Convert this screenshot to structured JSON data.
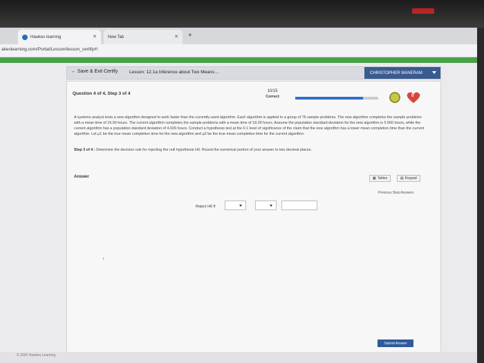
{
  "browser": {
    "tabs": [
      {
        "label": "Hawkes learning",
        "active": true
      },
      {
        "label": "New Tab",
        "active": false
      }
    ],
    "url": "akeslearning.com/Portal/Lesson/lesson_certify#!"
  },
  "nav": {
    "back_label": "Save & Exit Certify",
    "lesson_title": "Lesson: 12.1a Inference about Two Means:...",
    "user_name": "CHRISTOPHER MANERAM"
  },
  "question": {
    "header": "Question 4 of 4, Step 3 of 4",
    "score_value": "10/15",
    "score_status": "Correct",
    "progress": 0.82,
    "hearts": "0",
    "problem_text": "A systems analyst tests a new algorithm designed to work faster than the currently-used algorithm. Each algorithm is applied to a group of 76 sample problems. The new algorithm completes the sample problems with a mean time of 15.90 hours. The current algorithm completes the sample problems with a mean time of 18.29 hours. Assume the population standard deviation for the new algorithm is 5.560 hours, while the current algorithm has a population standard deviation of 4.026 hours. Conduct a hypothesis test at the 0.1 level of significance of the claim that the new algorithm has a lower mean completion time than the current algorithm. Let μ1 be the true mean completion time for the new algorithm and μ2 be the true mean completion time for the current algorithm.",
    "step_label": "Step 3 of 4 :",
    "step_text": "Determine the decision rule for rejecting the null hypothesis H0. Round the numerical portion of your answer to two decimal places."
  },
  "answer": {
    "label": "Answer",
    "tables_label": "Tables",
    "keypad_label": "Keypad",
    "previous_answers_label": "Previous Step Answers",
    "reject_label": "Reject H0 if",
    "submit_label": "Submit Answer"
  },
  "footer": {
    "copyright": "© 2020 Hawkes Learning"
  },
  "colors": {
    "appbar": "#49a047",
    "user_badge": "#3a5b8f",
    "progress": "#2f72c5",
    "heart": "#d9463a",
    "submit": "#2f5b9a"
  }
}
